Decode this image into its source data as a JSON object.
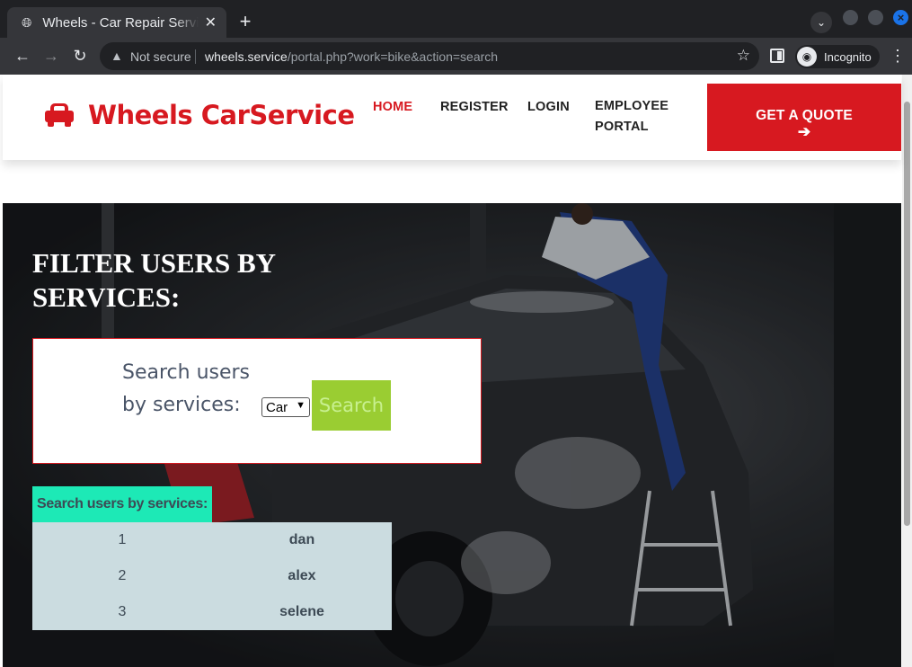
{
  "browser": {
    "tab_title": "Wheels - Car Repair Service",
    "new_tab_symbol": "+",
    "url_host": "wheels.service",
    "url_path": "/portal.php?work=bike&action=search",
    "security_label": "Not secure",
    "incognito_label": "Incognito"
  },
  "header": {
    "brand": "Wheels CarService",
    "nav": [
      {
        "label": "HOME",
        "active": true
      },
      {
        "label": "REGISTER"
      },
      {
        "label": "LOGIN"
      },
      {
        "label": "EMPLOYEE PORTAL"
      }
    ],
    "cta_label": "GET A QUOTE",
    "cta_arrow": "➔"
  },
  "main": {
    "title": "FILTER USERS BY SERVICES:",
    "search": {
      "label": "Search users by services:",
      "selected_service": "Car",
      "button_label": "Search"
    },
    "results": {
      "header": "Search users by services:",
      "rows": [
        {
          "id": "1",
          "name": "dan"
        },
        {
          "id": "2",
          "name": "alex"
        },
        {
          "id": "3",
          "name": "selene"
        }
      ]
    }
  },
  "colors": {
    "brand_red": "#d71920",
    "search_green": "#9acd32",
    "results_header_teal": "#1de9b6",
    "results_bg": "#cbdce0"
  }
}
